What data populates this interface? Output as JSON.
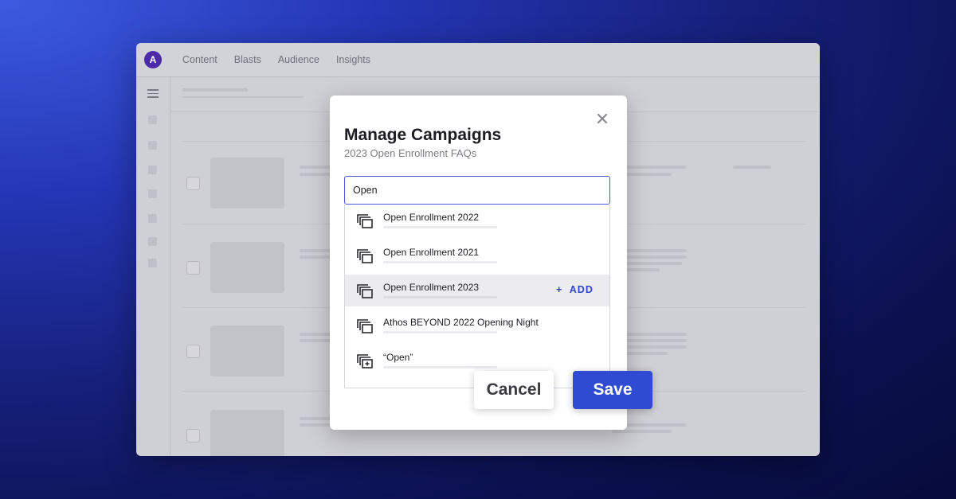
{
  "app": {
    "logo_letter": "A",
    "nav": [
      "Content",
      "Blasts",
      "Audience",
      "Insights"
    ]
  },
  "modal": {
    "title": "Manage Campaigns",
    "subtitle": "2023 Open Enrollment FAQs",
    "search": {
      "value": "Open",
      "placeholder": ""
    },
    "results": [
      {
        "label": "Open Enrollment 2022",
        "icon": "campaign-stack-icon",
        "highlighted": false
      },
      {
        "label": "Open Enrollment 2021",
        "icon": "campaign-stack-icon",
        "highlighted": false
      },
      {
        "label": "Open Enrollment 2023",
        "icon": "campaign-stack-icon",
        "highlighted": true
      },
      {
        "label": "Athos BEYOND 2022 Opening Night",
        "icon": "campaign-stack-icon",
        "highlighted": false
      },
      {
        "label": "“Open”",
        "icon": "create-campaign-icon",
        "highlighted": false
      }
    ],
    "add_label": "+  ADD",
    "cancel_label": "Cancel",
    "save_label": "Save"
  },
  "colors": {
    "accent": "#2f4bd1",
    "logo": "#4c2ba8",
    "highlight_row": "#ebebf0"
  }
}
